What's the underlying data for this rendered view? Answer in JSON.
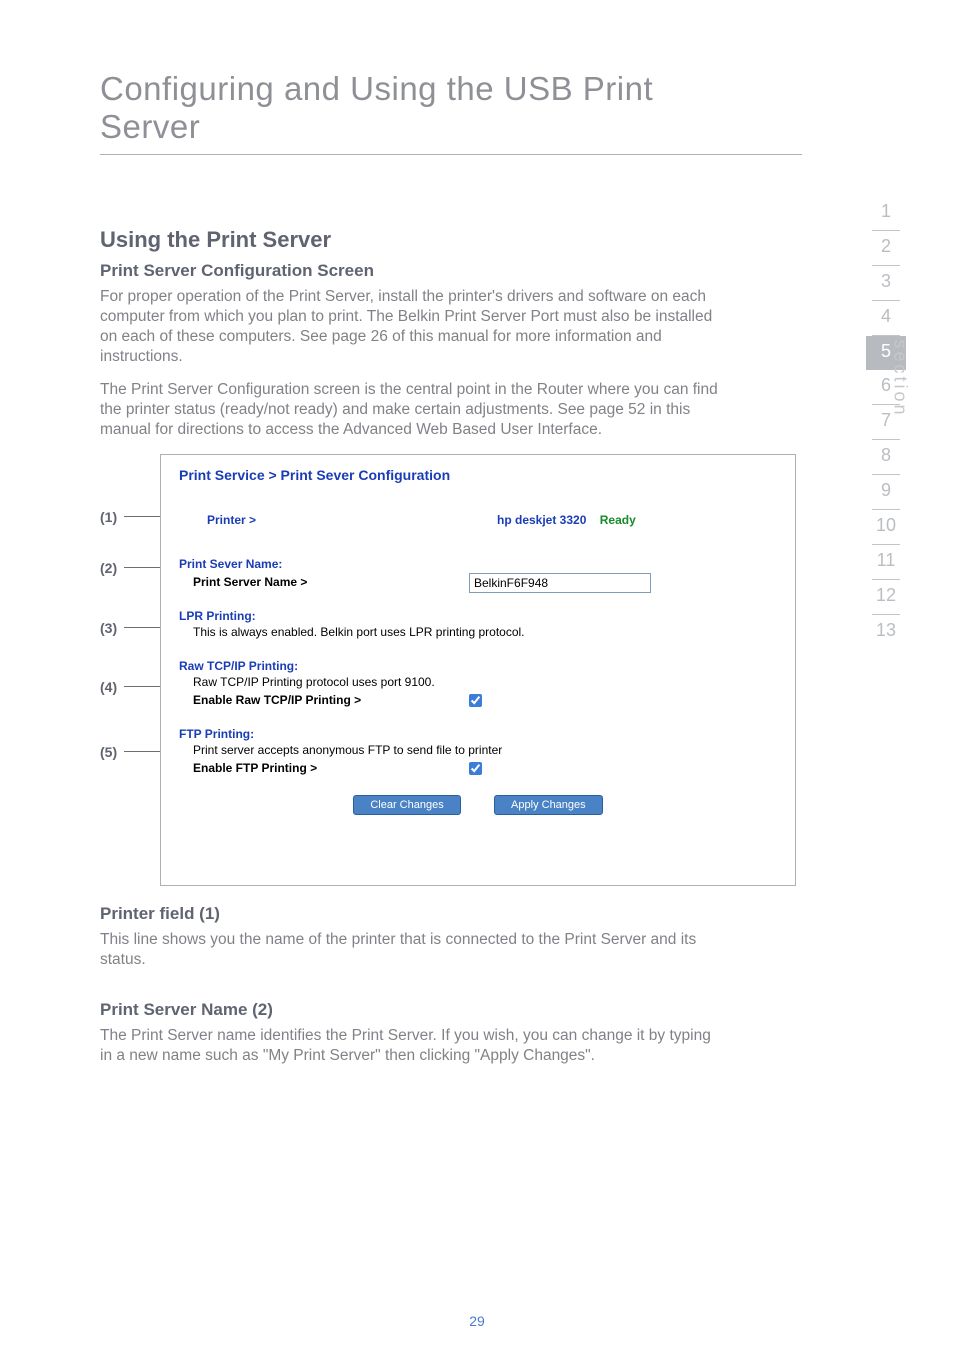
{
  "chapter_title": "Configuring and Using the USB Print Server",
  "section_heading": "Using the Print Server",
  "sub1_heading": "Print Server Configuration Screen",
  "para1": "For proper operation of the Print Server, install the printer's drivers and software on each computer from which you plan to print. The Belkin Print Server Port must also be installed on each of these computers. See page 26 of this manual for more information and instructions.",
  "para2": "The Print Server Configuration screen is the central point in the Router where you can find the printer status (ready/not ready) and make certain adjustments. See page 52 in this manual for directions to access the Advanced Web Based User Interface.",
  "screenshot": {
    "breadcrumb": "Print Service > Print Sever Configuration",
    "printer_label": "Printer >",
    "printer_name": "hp deskjet 3320",
    "printer_status": "Ready",
    "name_heading": "Print Sever Name:",
    "name_label": "Print Server Name >",
    "name_value": "BelkinF6F948",
    "lpr_heading": "LPR Printing:",
    "lpr_text": "This is always enabled. Belkin port uses LPR printing protocol.",
    "raw_heading": "Raw TCP/IP Printing:",
    "raw_text": "Raw TCP/IP Printing protocol uses port 9100.",
    "raw_enable_label": "Enable Raw TCP/IP Printing >",
    "ftp_heading": "FTP Printing:",
    "ftp_text": "Print server accepts anonymous FTP to send file to printer",
    "ftp_enable_label": "Enable FTP Printing >",
    "clear_btn": "Clear Changes",
    "apply_btn": "Apply Changes"
  },
  "callouts": {
    "c1": "(1)",
    "c2": "(2)",
    "c3": "(3)",
    "c4": "(4)",
    "c5": "(5)"
  },
  "printer_field_heading": "Printer field (1)",
  "printer_field_text": "This line shows you the name of the printer that is connected to the Print Server and its status.",
  "server_name_heading": "Print Server Name (2)",
  "server_name_text": "The Print Server name identifies the Print Server. If you wish, you can change it by typing in a new name such as \"My Print Server\" then clicking \"Apply Changes\".",
  "page_number": "29",
  "side": {
    "label": "section",
    "items": [
      "1",
      "2",
      "3",
      "4",
      "5",
      "6",
      "7",
      "8",
      "9",
      "10",
      "11",
      "12",
      "13"
    ],
    "active_index": 4
  }
}
